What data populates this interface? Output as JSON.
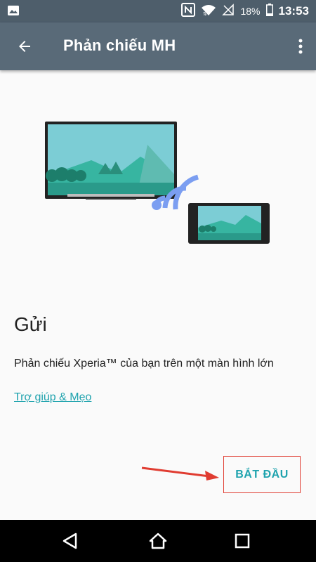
{
  "status_bar": {
    "battery": "18%",
    "time": "13:53",
    "icons": [
      "image-icon",
      "nfc-icon",
      "wifi-icon",
      "signal-off-icon",
      "battery-icon"
    ]
  },
  "app_bar": {
    "title": "Phản chiếu MH",
    "back_icon": "arrow-back-icon",
    "menu_icon": "more-vert-icon"
  },
  "content": {
    "heading": "Gửi",
    "description": "Phản chiếu Xperia™ của bạn trên một màn hình lớn",
    "help_link": "Trợ giúp & Mẹo",
    "start_button": "BẮT ĐẦU"
  },
  "nav_bar": {
    "icons": [
      "back-triangle-icon",
      "home-icon",
      "recents-icon"
    ]
  },
  "colors": {
    "status_bar": "#4e5e6b",
    "app_bar": "#596a78",
    "accent": "#1fa3ae",
    "annotation_red": "#e03c31",
    "wave_blue": "#7b9ef1"
  }
}
